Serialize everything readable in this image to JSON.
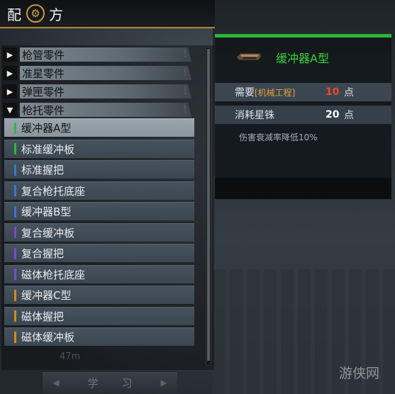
{
  "header": {
    "title_left": "配",
    "title_right": "方",
    "icon": "gear-hex-icon"
  },
  "categories": [
    {
      "label": "枪管零件",
      "expanded": false,
      "icon": "arrow-right-icon"
    },
    {
      "label": "准星零件",
      "expanded": false,
      "icon": "arrow-right-icon"
    },
    {
      "label": "弹匣零件",
      "expanded": false,
      "icon": "arrow-right-icon"
    },
    {
      "label": "枪托零件",
      "expanded": true,
      "icon": "arrow-down-icon"
    }
  ],
  "category_arrows": {
    "collapsed": "▶",
    "expanded": "▼"
  },
  "items": [
    {
      "label": "缓冲器A型",
      "rarity_color": "#2fb83c",
      "selected": true
    },
    {
      "label": "标准缓冲板",
      "rarity_color": "#2fb83c",
      "selected": false
    },
    {
      "label": "标准握把",
      "rarity_color": "#3a78c8",
      "selected": false
    },
    {
      "label": "复合枪托底座",
      "rarity_color": "#3a78c8",
      "selected": false
    },
    {
      "label": "缓冲器B型",
      "rarity_color": "#3a78c8",
      "selected": false
    },
    {
      "label": "复合缓冲板",
      "rarity_color": "#7a4cc8",
      "selected": false
    },
    {
      "label": "复合握把",
      "rarity_color": "#7a4cc8",
      "selected": false
    },
    {
      "label": "磁体枪托底座",
      "rarity_color": "#7a4cc8",
      "selected": false
    },
    {
      "label": "缓冲器C型",
      "rarity_color": "#d88a1e",
      "selected": false
    },
    {
      "label": "磁体握把",
      "rarity_color": "#d88a1e",
      "selected": false
    },
    {
      "label": "磁体缓冲板",
      "rarity_color": "#d88a1e",
      "selected": false
    }
  ],
  "list_footer_faded": "47m",
  "learn": {
    "label": "学 习",
    "prev_icon": "triangle-left-icon",
    "next_icon": "triangle-right-icon"
  },
  "detail": {
    "item_name": "缓冲器A型",
    "item_icon": "buffer-part-icon",
    "requirements": [
      {
        "label": "需要",
        "tag": "[机械工程]",
        "value": "10",
        "value_color": "#ee4a2a",
        "unit": "点"
      },
      {
        "label": "消耗星铢",
        "tag": "",
        "value": "20",
        "value_color": "#ffffff",
        "unit": "点"
      }
    ],
    "description": "伤害衰减率降低10%"
  },
  "watermark": "游侠网",
  "colors": {
    "accent_gold": "#b9862e",
    "accent_green": "#29b536"
  }
}
